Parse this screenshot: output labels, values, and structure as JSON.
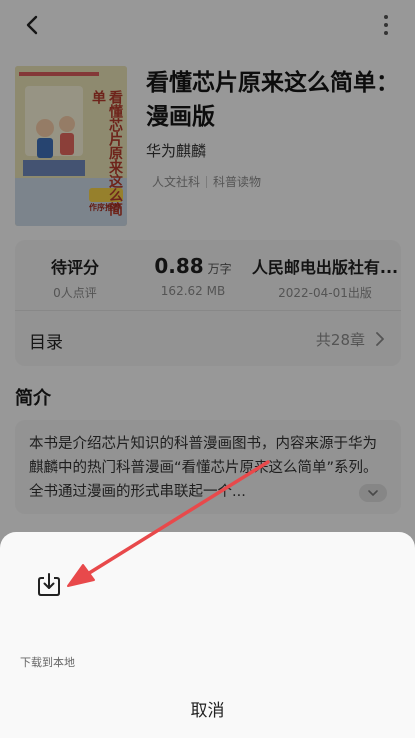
{
  "header": {
    "back_icon": "chevron-left-icon",
    "more_icon": "more-vertical-icon"
  },
  "book": {
    "title": "看懂芯片原来这么简单：漫画版",
    "author": "华为麒麟",
    "tags": [
      "人文社科",
      "科普读物"
    ],
    "cover": {
      "title_text": "看懂芯片原来这么简单",
      "badge_text": "作序推荐"
    }
  },
  "info": {
    "rating_value": "待评分",
    "rating_count": "0人点评",
    "word_count_value": "0.88",
    "word_count_unit": "万字",
    "file_size": "162.62 MB",
    "publisher": "人民邮电出版社有...",
    "publish_date": "2022-04-01出版"
  },
  "toc": {
    "label": "目录",
    "count": "共28章"
  },
  "intro": {
    "title": "简介",
    "text": "本书是介绍芯片知识的科普漫画图书，内容来源于华为麒麟中的热门科普漫画“看懂芯片原来这么简单”系列。全书通过漫画的形式串联起一个..."
  },
  "sheet": {
    "download_label": "下载到本地",
    "download_icon": "download-icon",
    "cancel_label": "取消"
  },
  "colors": {
    "annotation_arrow": "#e8494b",
    "cover_accent": "#e8772a"
  }
}
